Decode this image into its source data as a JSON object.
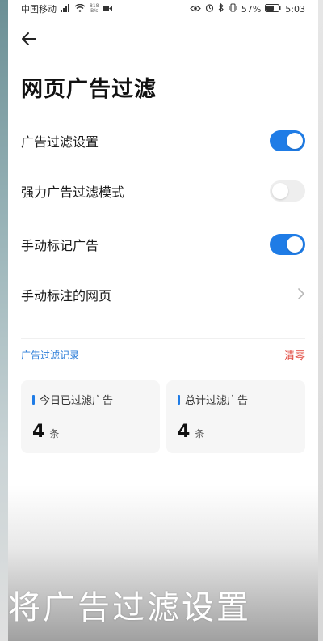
{
  "status_bar": {
    "carrier": "中国移动",
    "net_speed_top": "818",
    "net_speed_bottom": "B/s",
    "battery_percent": "57%",
    "time": "5:03"
  },
  "header": {
    "title": "网页广告过滤"
  },
  "settings": [
    {
      "label": "广告过滤设置",
      "control": "toggle",
      "state": "on"
    },
    {
      "label": "强力广告过滤模式",
      "control": "toggle",
      "state": "off"
    },
    {
      "label": "手动标记广告",
      "control": "toggle",
      "state": "on"
    },
    {
      "label": "手动标注的网页",
      "control": "chevron"
    }
  ],
  "records": {
    "section_title": "广告过滤记录",
    "clear_label": "清零",
    "today": {
      "label": "今日已过滤广告",
      "value": "4",
      "unit": "条"
    },
    "total": {
      "label": "总计过滤广告",
      "value": "4",
      "unit": "条"
    }
  },
  "overlay_caption": "将广告过滤设置",
  "colors": {
    "accent": "#1f7ce6",
    "danger": "#e0453b",
    "section_blue": "#2a7cd8"
  },
  "icons": [
    "back-arrow-icon",
    "chevron-right-icon",
    "wifi-icon",
    "battery-icon",
    "bluetooth-icon",
    "eye-icon",
    "alarm-icon",
    "vibrate-icon",
    "video-icon",
    "signal-icon"
  ]
}
